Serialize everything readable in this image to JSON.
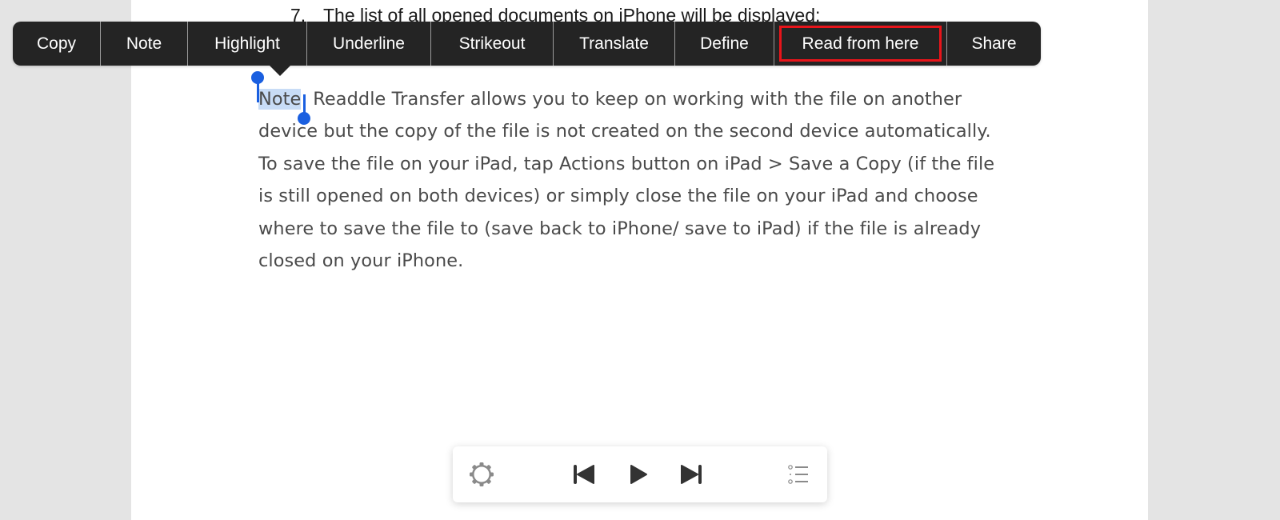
{
  "document": {
    "previous_item_number": "7.",
    "previous_item_text": "The list of all opened documents on iPhone will be displayed:",
    "paragraph_selected_word": "Note",
    "paragraph_lines": [
      ": Readdle Transfer allows you to keep on working with the file on another",
      "device but the copy of the file is not created on the second device automatically.",
      "To save the file on your iPad, tap Actions button on iPad > Save a Copy (if the file",
      "is still opened on both devices) or simply close the file on your iPad and choose",
      "where to save the file to (save back to iPhone/ save to iPad) if the file is already",
      "closed on your iPhone."
    ]
  },
  "context_menu": {
    "items": [
      {
        "label": "Copy"
      },
      {
        "label": "Note"
      },
      {
        "label": "Highlight"
      },
      {
        "label": "Underline"
      },
      {
        "label": "Strikeout"
      },
      {
        "label": "Translate"
      },
      {
        "label": "Define"
      },
      {
        "label": "Read from here",
        "highlighted": true
      },
      {
        "label": "Share"
      }
    ],
    "highlight_color": "#e8141a"
  },
  "player": {
    "icons": [
      "gear-icon",
      "skip-previous-icon",
      "play-icon",
      "skip-next-icon",
      "list-icon"
    ]
  },
  "colors": {
    "selection": "#c8dcf6",
    "handle": "#1a5fe0",
    "background": "#e4e4e4"
  }
}
